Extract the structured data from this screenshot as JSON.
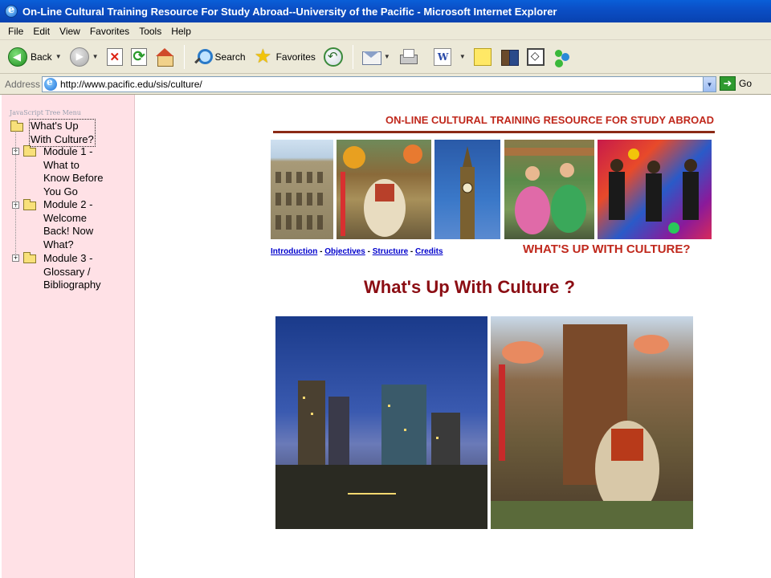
{
  "window": {
    "title": "On-Line Cultural Training Resource For Study Abroad--University of the Pacific - Microsoft Internet Explorer"
  },
  "menu": [
    "File",
    "Edit",
    "View",
    "Favorites",
    "Tools",
    "Help"
  ],
  "toolbar": {
    "back_label": "Back",
    "search_label": "Search",
    "favorites_label": "Favorites"
  },
  "address": {
    "label": "Address",
    "url": "http://www.pacific.edu/sis/culture/",
    "go_label": "Go"
  },
  "sidebar": {
    "caption": "JavaScript Tree Menu",
    "items": [
      {
        "lines": [
          "What's Up",
          "With Culture?"
        ],
        "selected": true
      },
      {
        "lines": [
          "Module 1 -",
          "What to",
          "Know Before",
          "You Go"
        ],
        "selected": false
      },
      {
        "lines": [
          "Module 2 -",
          "Welcome",
          "Back! Now",
          "What?"
        ],
        "selected": false
      },
      {
        "lines": [
          "Module 3 -",
          "Glossary /",
          "Bibliography"
        ],
        "selected": false
      }
    ]
  },
  "page": {
    "banner": "ON-LINE CULTURAL TRAINING RESOURCE FOR STUDY ABROAD",
    "nav_links": [
      "Introduction",
      "Objectives",
      "Structure",
      "Credits"
    ],
    "section_tag": "WHAT'S UP WITH CULTURE?",
    "main_title": "What's Up With Culture ?"
  },
  "colors": {
    "banner_red": "#c0281c",
    "title_red": "#8b0d13",
    "sidebar_pink": "#ffe1e6",
    "link_blue": "#0000cc"
  }
}
